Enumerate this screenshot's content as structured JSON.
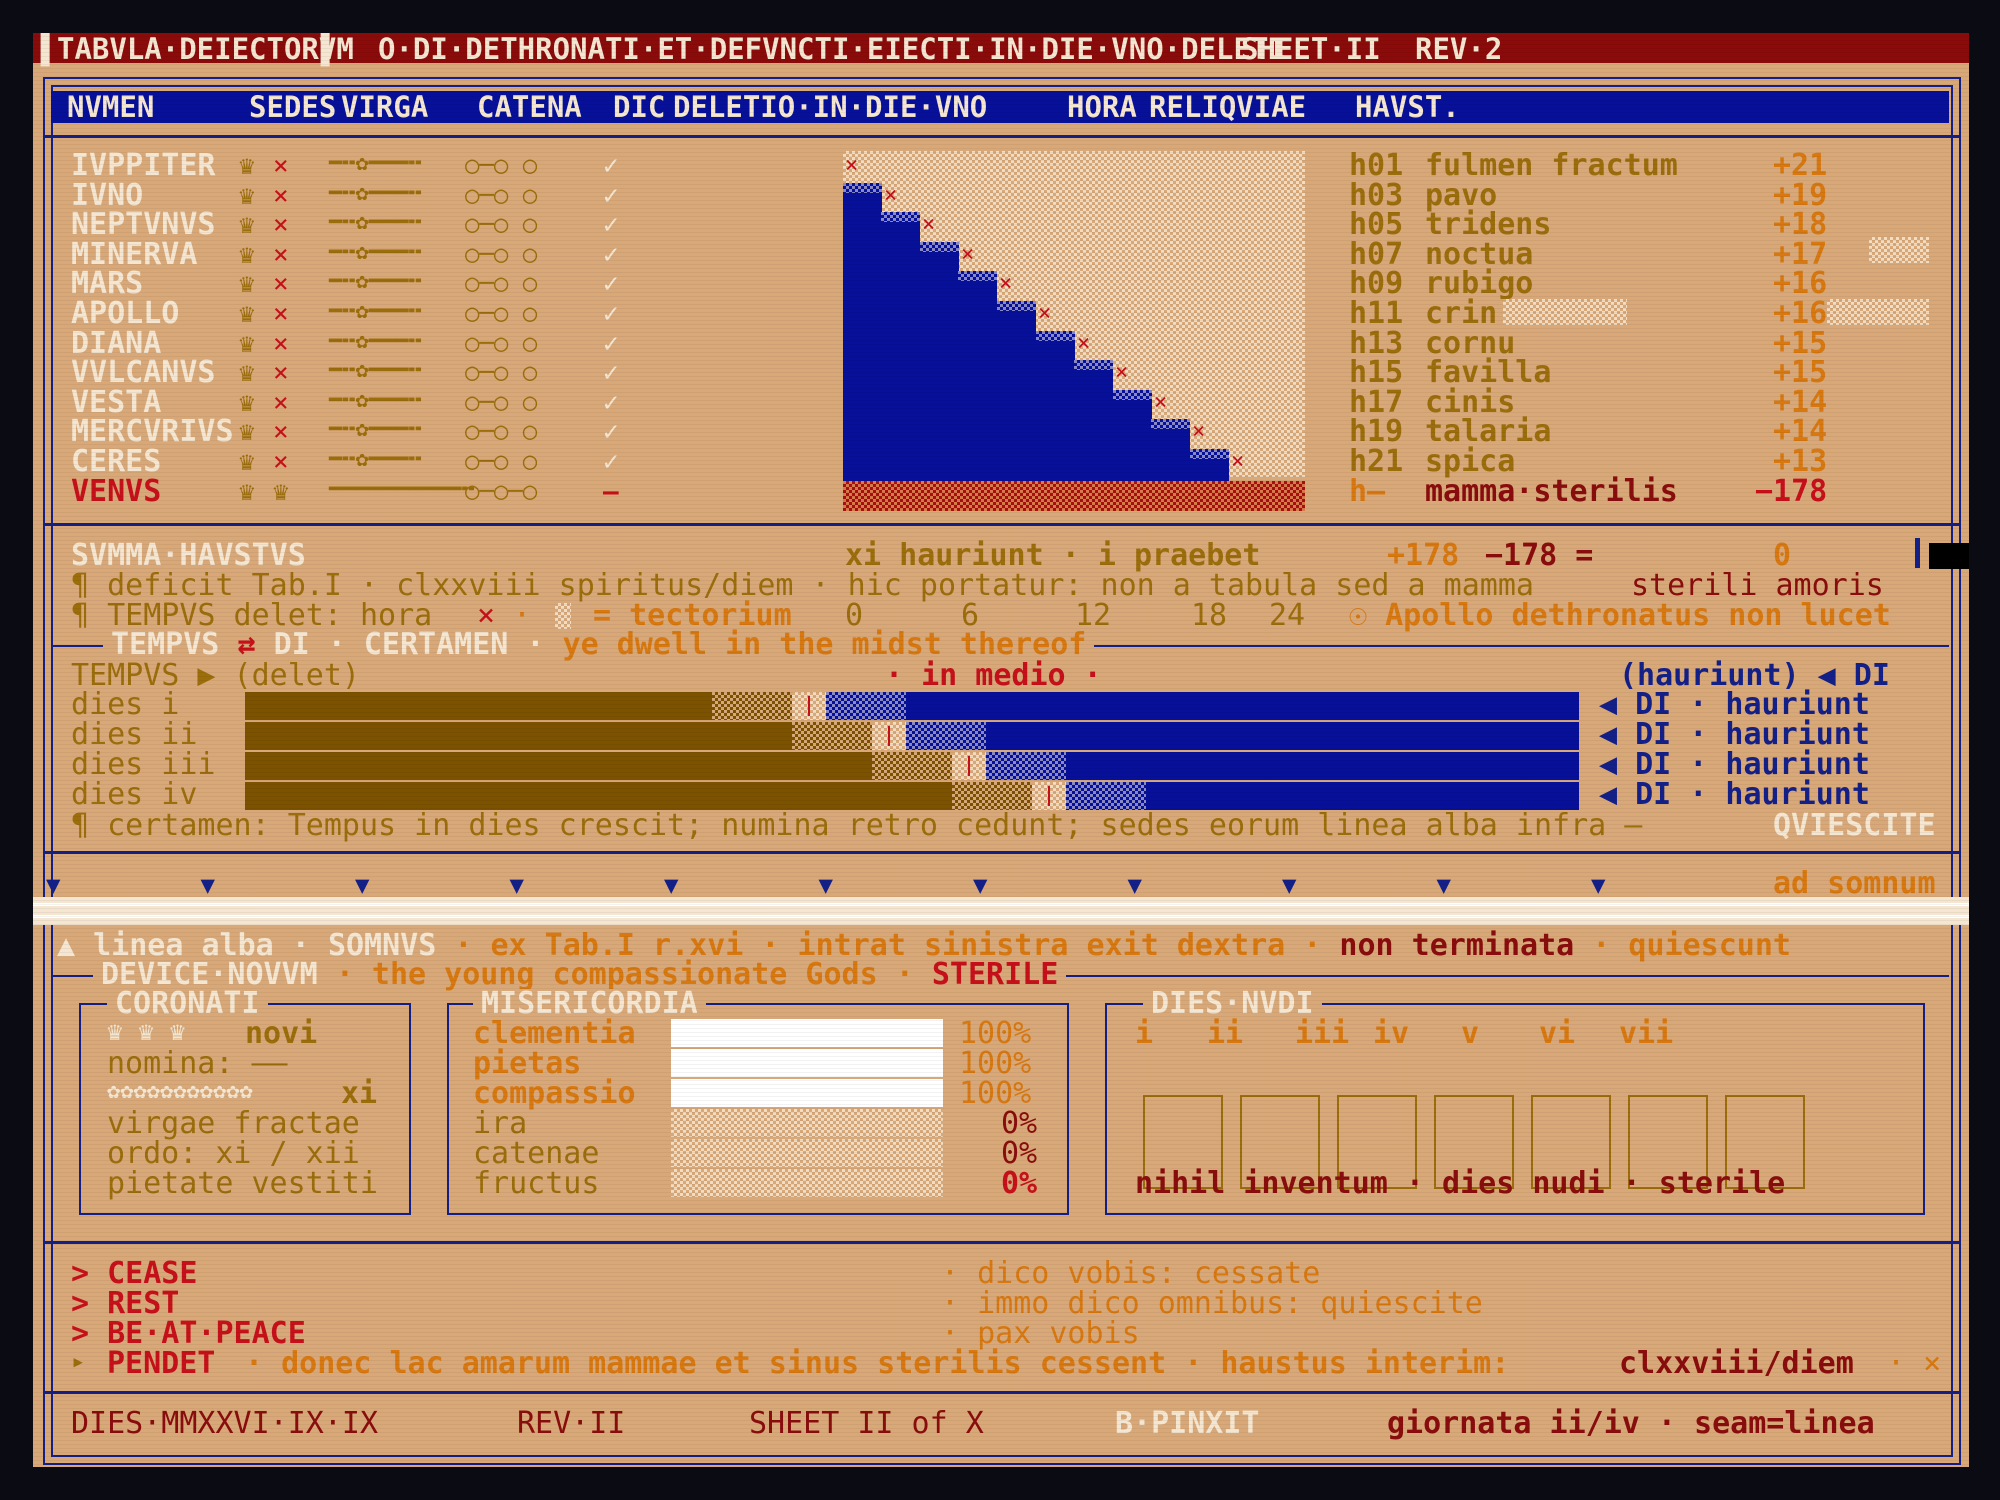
{
  "titlebar": {
    "title": "TABVLA·DEIECTORVM",
    "subtitle": "O·DI·DETHRONATI·ET·DEFVNCTI·EIECTI·IN·DIE·VNO·DELETI",
    "sheet": "SHEET·II",
    "rev": "REV·2"
  },
  "header": {
    "nomen": "NVMEN",
    "sedes": "SEDES",
    "virga": "VIRGA",
    "catena": "CATENA",
    "dic": "DIC",
    "deletio": "DELETIO·IN·DIE·VNO",
    "hora": "HORA",
    "reliquiae": "RELIQVIAE",
    "haust": "HAVST."
  },
  "gods": [
    {
      "name": "IVPPITER",
      "hour": "h01",
      "relic": "fulmen fractum",
      "haust": "+21"
    },
    {
      "name": "IVNO",
      "hour": "h03",
      "relic": "pavo",
      "haust": "+19"
    },
    {
      "name": "NEPTVNVS",
      "hour": "h05",
      "relic": "tridens",
      "haust": "+18"
    },
    {
      "name": "MINERVA",
      "hour": "h07",
      "relic": "noctua",
      "haust": "+17"
    },
    {
      "name": "MARS",
      "hour": "h09",
      "relic": "rubigo",
      "haust": "+16"
    },
    {
      "name": "APOLLO",
      "hour": "h11",
      "relic": "crin",
      "haust": "+16"
    },
    {
      "name": "DIANA",
      "hour": "h13",
      "relic": "cornu",
      "haust": "+15"
    },
    {
      "name": "VVLCANVS",
      "hour": "h15",
      "relic": "favilla",
      "haust": "+15"
    },
    {
      "name": "VESTA",
      "hour": "h17",
      "relic": "cinis",
      "haust": "+14"
    },
    {
      "name": "MERCVRIVS",
      "hour": "h19",
      "relic": "talaria",
      "haust": "+14"
    },
    {
      "name": "CERES",
      "hour": "h21",
      "relic": "spica",
      "haust": "+13"
    }
  ],
  "symbols": {
    "crown": "♛",
    "cross": "×",
    "virga": "━╍✿━━━╍",
    "virga_broken": "━━━━━━━━━━╍",
    "catena": "○─○ ○",
    "catena_venus": "○─○─○",
    "check": "✓",
    "dash": "—"
  },
  "venus": {
    "name": "VENVS",
    "hour": "h—",
    "relic": "mamma·sterilis",
    "haust": "−178"
  },
  "summa": {
    "label": "SVMMA·HAVSTVS",
    "text": "xi hauriunt · i praebet",
    "plus": "+178",
    "minus": "−178 =",
    "total": "0"
  },
  "deficit_line": "¶ deficit Tab.I · clxxviii spiritus/diem · hic portatur: non a tabula sed a mamma",
  "deficit_tail": "sterili amoris",
  "tempvs_line": {
    "prefix": "¶ TEMPVS delet: hora",
    "cross": "×",
    "dot": "·",
    "eq": "= tectorium",
    "ticks": [
      "0",
      "6",
      "12",
      "18",
      "24"
    ],
    "sun": "☉ Apollo dethronatus non lucet"
  },
  "certamen": {
    "title_a": "TEMPVS",
    "title_arrow": "⇄",
    "title_b": "DI · CERTAMEN ·",
    "title_c": "ye dwell in the midst thereof",
    "left_hdr": "TEMPVS ▶ (delet)",
    "mid_hdr": "· in medio ·",
    "right_hdr": "(hauriunt) ◀ DI",
    "rows": [
      {
        "label": "dies i",
        "tail": "◀ DI · hauriunt",
        "split": 0.35
      },
      {
        "label": "dies ii",
        "tail": "◀ DI · hauriunt",
        "split": 0.41
      },
      {
        "label": "dies iii",
        "tail": "◀ DI · hauriunt",
        "split": 0.47
      },
      {
        "label": "dies iv",
        "tail": "◀ DI · hauriunt",
        "split": 0.53
      }
    ],
    "note": "¶ certamen: Tempus in dies crescit; numina retro cedunt; sedes eorum linea alba infra —",
    "note_tail": "QVIESCITE"
  },
  "marker": {
    "arrow": "▼",
    "label": "ad somnum"
  },
  "somnvs_line": {
    "a": "▲ linea alba ·",
    "b": "SOMNVS",
    "c": "· ex Tab.I r.xvi · intrat sinistra exit dextra ·",
    "d": "non terminata",
    "e": "· quiescunt"
  },
  "device": {
    "title_a": "DEVICE·NOVVM",
    "title_b": "· the young compassionate Gods ·",
    "title_c": "STERILE"
  },
  "coronati": {
    "title": "CORONATI",
    "crowns": "♛ ♛ ♛",
    "novi": "novi",
    "nomina": "nomina: ——",
    "flowers": "✿✿✿✿✿✿✿✿✿✿✿",
    "xi": "xi",
    "lines": [
      "virgae fractae",
      "ordo: xi / xii",
      "pietate vestiti"
    ]
  },
  "misericordia": {
    "title": "MISERICORDIA",
    "rows": [
      {
        "label": "clementia",
        "pct": "100%",
        "value": 1.0
      },
      {
        "label": "pietas",
        "pct": "100%",
        "value": 1.0
      },
      {
        "label": "compassio",
        "pct": "100%",
        "value": 1.0
      },
      {
        "label": "ira",
        "pct": "0%",
        "value": 0.0
      },
      {
        "label": "catenae",
        "pct": "0%",
        "value": 0.0
      },
      {
        "label": "fructus",
        "pct": "0%",
        "value": 0.0
      }
    ]
  },
  "dies_nvdi": {
    "title": "DIES·NVDI",
    "days": [
      "i",
      "ii",
      "iii",
      "iv",
      "v",
      "vi",
      "vii"
    ],
    "note": "nihil inventum · dies nudi · sterile"
  },
  "commands": [
    {
      "cmd": "> CEASE",
      "gloss": "· dico vobis: cessate"
    },
    {
      "cmd": "> REST",
      "gloss": "· immo dico omnibus: quiescite"
    },
    {
      "cmd": "> BE·AT·PEACE",
      "gloss": "· pax vobis"
    }
  ],
  "pendet": {
    "arrow": "▸",
    "cmd": "PENDET",
    "text": "· donec lac amarum mammae et sinus sterilis cessent · haustus interim:",
    "value": "clxxviii/diem",
    "tail": "· ×"
  },
  "footer": {
    "date": "DIES·MMXXVI·IX·IX",
    "rev": "REV·II",
    "sheet": "SHEET II of X",
    "pinxit": "B·PINXIT",
    "giornata": "giornata ii/iv · seam=linea"
  },
  "colors": {
    "paper": "#d9a878",
    "navy": "#06109a",
    "gold": "#9c6e0a",
    "red": "#c8101a",
    "cream": "#f4e6d0"
  }
}
